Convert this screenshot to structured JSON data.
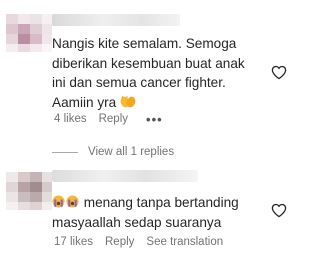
{
  "comments": [
    {
      "text": "Nangis kite semalam. Semoga diberikan kesembuan buat anak ini dan semua cancer fighter. Aamiin yra",
      "emoji": "clapping-hands",
      "likes": "4 likes",
      "reply": "Reply",
      "more": "•••"
    },
    {
      "emoji": "crying-face",
      "text": "menang tanpa bertanding masyaallah sedap suaranya",
      "likes": "17 likes",
      "reply": "Reply",
      "translate": "See translation"
    }
  ],
  "view_replies": "View all 1 replies",
  "colors": {
    "text": "#262626",
    "meta": "#737373",
    "emoji_yellow": "#f5b82e",
    "emoji_purple": "#8e63c9"
  }
}
